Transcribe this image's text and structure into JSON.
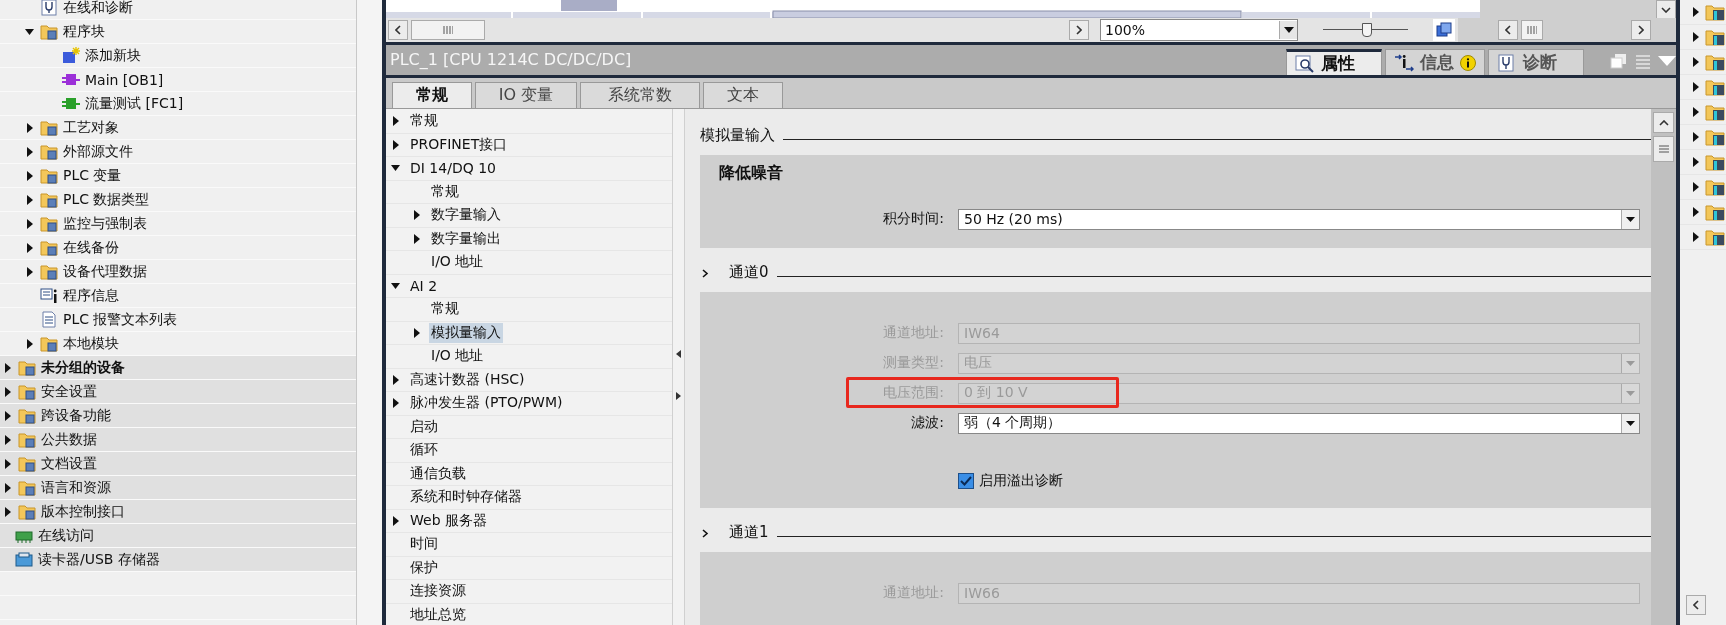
{
  "project_tree": [
    {
      "children": [
        {
          "children": [
            {
              "label": "在线和诊断",
              "kind": "diagnostics"
            },
            {
              "label": "程序块",
              "kind": "folder",
              "expanded": true,
              "children": [
                {
                  "label": "添加新块",
                  "kind": "add-block"
                },
                {
                  "label": "Main [OB1]",
                  "kind": "block",
                  "color": "#9b2fd8"
                },
                {
                  "label": "流量测试 [FC1]",
                  "kind": "block",
                  "color": "#2aa02a"
                }
              ]
            },
            {
              "label": "工艺对象",
              "kind": "folder",
              "expanded": false
            },
            {
              "label": "外部源文件",
              "kind": "folder",
              "expanded": false
            },
            {
              "label": "PLC 变量",
              "kind": "folder",
              "expanded": false
            },
            {
              "label": "PLC 数据类型",
              "kind": "folder",
              "expanded": false
            },
            {
              "label": "监控与强制表",
              "kind": "folder",
              "expanded": false
            },
            {
              "label": "在线备份",
              "kind": "folder",
              "expanded": false
            },
            {
              "label": "设备代理数据",
              "kind": "folder",
              "expanded": false
            },
            {
              "label": "程序信息",
              "kind": "info"
            },
            {
              "label": "PLC 报警文本列表",
              "kind": "document"
            },
            {
              "label": "本地模块",
              "kind": "folder",
              "expanded": false
            }
          ]
        },
        {
          "label": "未分组的设备",
          "kind": "folder",
          "expanded": false,
          "bold": true
        },
        {
          "label": "安全设置",
          "kind": "folder",
          "expanded": false
        },
        {
          "label": "跨设备功能",
          "kind": "folder",
          "expanded": false
        },
        {
          "label": "公共数据",
          "kind": "folder",
          "expanded": false
        },
        {
          "label": "文档设置",
          "kind": "folder",
          "expanded": false
        },
        {
          "label": "语言和资源",
          "kind": "folder",
          "expanded": false
        },
        {
          "label": "版本控制接口",
          "kind": "folder",
          "expanded": false
        }
      ]
    },
    {
      "label": "在线访问",
      "kind": "access"
    },
    {
      "label": "读卡器/USB 存储器",
      "kind": "card-reader"
    }
  ],
  "editor_toolbar": {
    "zoom": "100%",
    "zoom_slider": {
      "level": 0.5
    }
  },
  "inspector": {
    "title": "PLC_1 [CPU 1214C DC/DC/DC]",
    "view_tabs": [
      {
        "label": "属性",
        "kind": "properties",
        "selected": true
      },
      {
        "label": "信息",
        "kind": "info",
        "selected": false
      },
      {
        "label": "诊断",
        "kind": "diagnostics",
        "selected": false
      }
    ],
    "tabs": [
      {
        "label": "常规",
        "selected": true
      },
      {
        "label": "IO 变量",
        "selected": false
      },
      {
        "label": "系统常数",
        "selected": false
      },
      {
        "label": "文本",
        "selected": false
      }
    ],
    "nav": [
      {
        "label": "常规",
        "expanded": false,
        "selected": false
      },
      {
        "label": "PROFINET接口",
        "expanded": false,
        "selected": false
      },
      {
        "label": "DI 14/DQ 10",
        "expanded": true,
        "selected": false,
        "children": [
          {
            "label": "常规",
            "selected": false
          },
          {
            "label": "数字量输入",
            "expanded": false,
            "selected": false
          },
          {
            "label": "数字量输出",
            "expanded": false,
            "selected": false
          },
          {
            "label": "I/O 地址",
            "selected": false
          }
        ]
      },
      {
        "label": "AI 2",
        "expanded": true,
        "selected": false,
        "children": [
          {
            "label": "常规",
            "selected": false
          },
          {
            "label": "模拟量输入",
            "expanded": false,
            "selected": true
          },
          {
            "label": "I/O 地址",
            "selected": false
          }
        ]
      },
      {
        "label": "高速计数器 (HSC)",
        "expanded": false,
        "selected": false
      },
      {
        "label": "脉冲发生器 (PTO/PWM)",
        "expanded": false,
        "selected": false
      },
      {
        "label": "启动",
        "selected": false
      },
      {
        "label": "循环",
        "selected": false
      },
      {
        "label": "通信负载",
        "selected": false
      },
      {
        "label": "系统和时钟存储器",
        "selected": false
      },
      {
        "label": "Web 服务器",
        "expanded": false,
        "selected": false
      },
      {
        "label": "时间",
        "selected": false
      },
      {
        "label": "保护",
        "selected": false
      },
      {
        "label": "连接资源",
        "selected": false
      },
      {
        "label": "地址总览",
        "selected": false
      }
    ],
    "sections": [
      {
        "title": "模拟量输入",
        "kind": "plain",
        "panel": {
          "heading": "降低噪音",
          "fields": [
            {
              "label": "积分时间:",
              "value": "50 Hz (20 ms)",
              "kind": "dropdown",
              "disabled": false,
              "highlighted": false
            }
          ]
        }
      },
      {
        "title": "通道0",
        "kind": "collapsible",
        "panel": {
          "fields": [
            {
              "label": "通道地址:",
              "value": "IW64",
              "kind": "text",
              "disabled": true,
              "highlighted": false
            },
            {
              "label": "测量类型:",
              "value": "电压",
              "kind": "dropdown",
              "disabled": true,
              "highlighted": false
            },
            {
              "label": "电压范围:",
              "value": "0 到 10 V",
              "kind": "dropdown",
              "disabled": true,
              "highlighted": true
            },
            {
              "label": "滤波:",
              "value": "弱（4 个周期）",
              "kind": "dropdown",
              "disabled": false,
              "highlighted": false
            }
          ],
          "checkbox": {
            "label": "启用溢出诊断",
            "checked": true
          }
        }
      },
      {
        "title": "通道1",
        "kind": "collapsible",
        "panel": {
          "fields": [
            {
              "label": "通道地址:",
              "value": "IW66",
              "kind": "text",
              "disabled": true,
              "highlighted": false
            }
          ]
        }
      }
    ]
  },
  "library_tree": [
    {
      "expanded": false
    },
    {
      "expanded": false
    },
    {
      "expanded": false
    },
    {
      "expanded": false
    },
    {
      "expanded": false
    },
    {
      "expanded": false
    },
    {
      "expanded": false
    },
    {
      "expanded": false
    },
    {
      "expanded": false
    },
    {
      "expanded": false
    }
  ]
}
